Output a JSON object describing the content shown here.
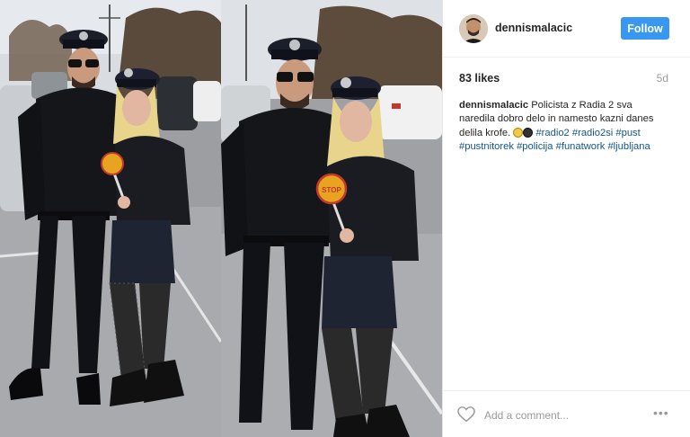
{
  "post": {
    "username": "dennismalacic",
    "follow_label": "Follow",
    "likes": "83 likes",
    "age": "5d",
    "caption": {
      "username": "dennismalacic",
      "text": "Policista z Radia 2 sva naredila dobro delo in namesto kazni danes delila krofe.",
      "tags": [
        "#radio2",
        "#radio2si",
        "#pust",
        "#pustnitorek",
        "#policija",
        "#funatwork",
        "#ljubljana"
      ]
    },
    "comment_placeholder": "Add a comment...",
    "more_label": "•••",
    "sign_text": "STOP",
    "icons": [
      "heart-icon",
      "more-options-icon"
    ]
  },
  "colors": {
    "follow_button": "#3897f0",
    "hashtag": "#125688",
    "meta_gray": "#999999"
  }
}
